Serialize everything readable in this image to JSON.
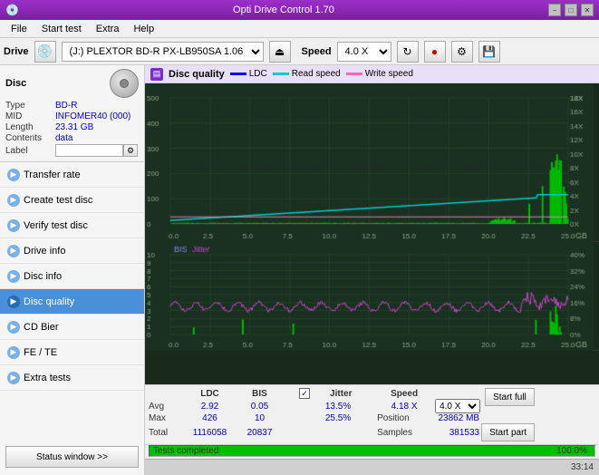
{
  "titlebar": {
    "title": "Opti Drive Control 1.70",
    "min": "−",
    "max": "□",
    "close": "✕"
  },
  "menu": {
    "items": [
      "File",
      "Start test",
      "Extra",
      "Help"
    ]
  },
  "drivebar": {
    "drive_label": "Drive",
    "drive_value": "(J:)  PLEXTOR BD-R  PX-LB950SA 1.06",
    "speed_label": "Speed",
    "speed_value": "4.0 X"
  },
  "disc": {
    "title": "Disc",
    "type_label": "Type",
    "type_value": "BD-R",
    "mid_label": "MID",
    "mid_value": "INFOMER40 (000)",
    "length_label": "Length",
    "length_value": "23.31 GB",
    "contents_label": "Contents",
    "contents_value": "data",
    "label_label": "Label",
    "label_value": ""
  },
  "nav": {
    "items": [
      {
        "id": "transfer-rate",
        "label": "Transfer rate",
        "active": false
      },
      {
        "id": "create-test-disc",
        "label": "Create test disc",
        "active": false
      },
      {
        "id": "verify-test-disc",
        "label": "Verify test disc",
        "active": false
      },
      {
        "id": "drive-info",
        "label": "Drive info",
        "active": false
      },
      {
        "id": "disc-info",
        "label": "Disc info",
        "active": false
      },
      {
        "id": "disc-quality",
        "label": "Disc quality",
        "active": true
      },
      {
        "id": "cd-bier",
        "label": "CD Bier",
        "active": false
      },
      {
        "id": "fe-te",
        "label": "FE / TE",
        "active": false
      },
      {
        "id": "extra-tests",
        "label": "Extra tests",
        "active": false
      }
    ]
  },
  "status_btn": "Status window >>",
  "chart": {
    "title": "Disc quality",
    "legend": {
      "ldc": "LDC",
      "read_speed": "Read speed",
      "write_speed": "Write speed"
    },
    "legend2": {
      "bis": "BIS",
      "jitter": "Jitter"
    }
  },
  "stats": {
    "headers": [
      "",
      "LDC",
      "BIS",
      "",
      "Jitter",
      "Speed",
      "",
      ""
    ],
    "avg_label": "Avg",
    "avg_ldc": "2.92",
    "avg_bis": "0.05",
    "avg_jitter": "13.5%",
    "max_label": "Max",
    "max_ldc": "426",
    "max_bis": "10",
    "max_jitter": "25.5%",
    "total_label": "Total",
    "total_ldc": "1116058",
    "total_bis": "20837",
    "speed_label": "Speed",
    "speed_value": "4.18 X",
    "speed_select": "4.0 X",
    "position_label": "Position",
    "position_value": "23862 MB",
    "samples_label": "Samples",
    "samples_value": "381533",
    "start_full": "Start full",
    "start_part": "Start part",
    "jitter_checked": true,
    "jitter_label": "Jitter"
  },
  "progress": {
    "label": "Tests completed",
    "value": "100.0%",
    "fill_pct": 100
  },
  "time": "33:14",
  "colors": {
    "accent_purple": "#7a1fa0",
    "active_nav": "#4a90d9",
    "ldc_bar": "#00cc00",
    "read_speed": "#00cccc",
    "write_speed": "#ff69b4",
    "bis_bar": "#00cc00",
    "jitter_line": "#cc44cc",
    "chart_bg": "#1a3a1a",
    "grid_line": "#2a5a2a"
  }
}
